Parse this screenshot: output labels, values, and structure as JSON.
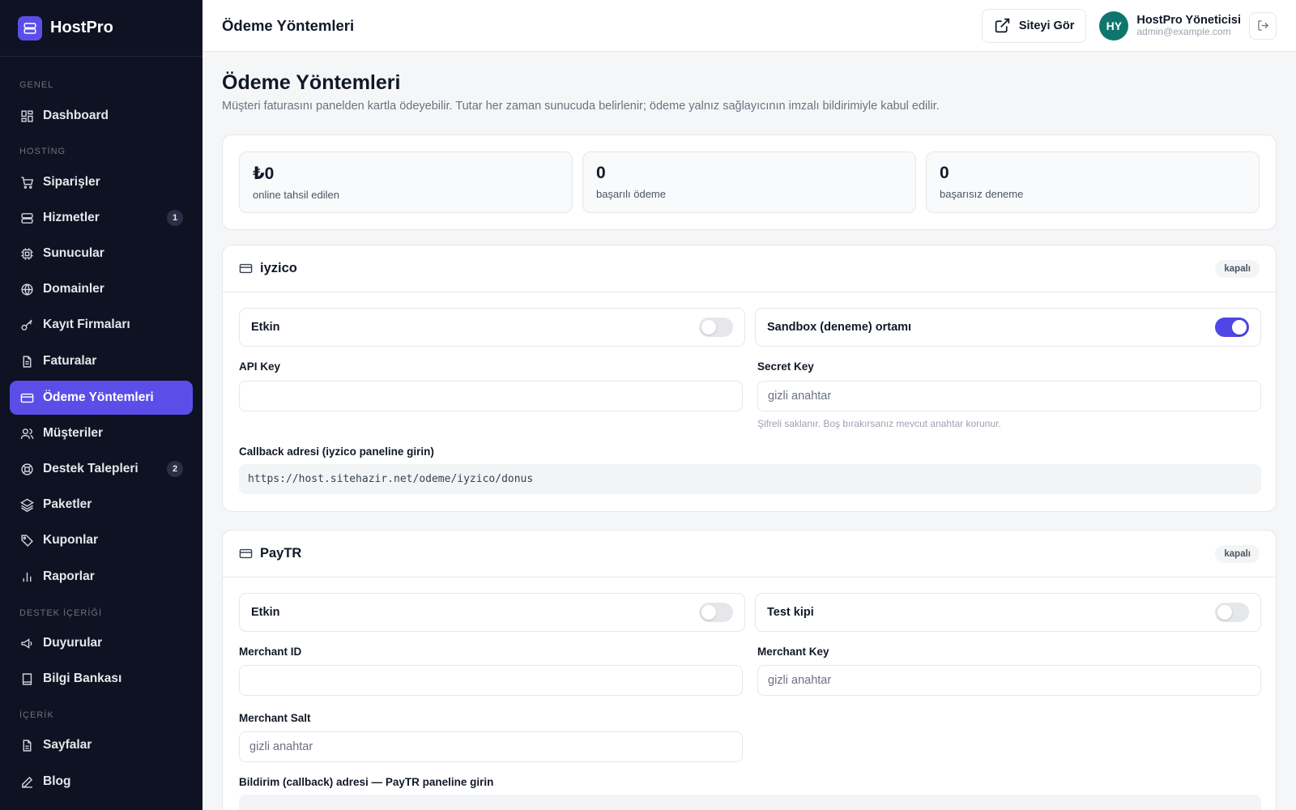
{
  "brand": {
    "name": "HostPro"
  },
  "sidebar": {
    "sections": [
      {
        "label": "GENEL"
      },
      {
        "label": "HOSTİNG"
      },
      {
        "label": "DESTEK İÇERİĞİ"
      },
      {
        "label": "İÇERİK"
      }
    ],
    "items": [
      {
        "label": "Dashboard",
        "icon": "dashboard-icon"
      },
      {
        "label": "Siparişler",
        "icon": "cart-icon"
      },
      {
        "label": "Hizmetler",
        "icon": "server-icon",
        "badge": "1"
      },
      {
        "label": "Sunucular",
        "icon": "cpu-icon"
      },
      {
        "label": "Domainler",
        "icon": "globe-icon"
      },
      {
        "label": "Kayıt Firmaları",
        "icon": "key-icon"
      },
      {
        "label": "Faturalar",
        "icon": "invoice-icon"
      },
      {
        "label": "Ödeme Yöntemleri",
        "icon": "credit-card-icon",
        "active": true
      },
      {
        "label": "Müşteriler",
        "icon": "users-icon"
      },
      {
        "label": "Destek Talepleri",
        "icon": "lifebuoy-icon",
        "badge": "2"
      },
      {
        "label": "Paketler",
        "icon": "layers-icon"
      },
      {
        "label": "Kuponlar",
        "icon": "tag-icon"
      },
      {
        "label": "Raporlar",
        "icon": "bar-chart-icon"
      },
      {
        "label": "Duyurular",
        "icon": "megaphone-icon"
      },
      {
        "label": "Bilgi Bankası",
        "icon": "book-icon"
      },
      {
        "label": "Sayfalar",
        "icon": "file-icon"
      },
      {
        "label": "Blog",
        "icon": "edit-icon"
      }
    ]
  },
  "topbar": {
    "title": "Ödeme Yöntemleri",
    "view_site": "Siteyi Gör",
    "user": {
      "initials": "HY",
      "name": "HostPro Yöneticisi",
      "email": "admin@example.com"
    }
  },
  "page": {
    "title": "Ödeme Yöntemleri",
    "description": "Müşteri faturasını panelden kartla ödeyebilir. Tutar her zaman sunucuda belirlenir; ödeme yalnız sağlayıcının imzalı bildirimiyle kabul edilir."
  },
  "stats": [
    {
      "value": "₺0",
      "label": "online tahsil edilen"
    },
    {
      "value": "0",
      "label": "başarılı ödeme"
    },
    {
      "value": "0",
      "label": "başarısız deneme"
    }
  ],
  "iyzico": {
    "name": "iyzico",
    "status": "kapalı",
    "enabled_label": "Etkin",
    "enabled": false,
    "sandbox_label": "Sandbox (deneme) ortamı",
    "sandbox": true,
    "api_key_label": "API Key",
    "api_key_value": "",
    "secret_key_label": "Secret Key",
    "secret_key_placeholder": "gizli anahtar",
    "secret_hint": "Şifreli saklanır. Boş bırakırsanız mevcut anahtar korunur.",
    "callback_label": "Callback adresi (iyzico paneline girin)",
    "callback_url": "https://host.sitehazir.net/odeme/iyzico/donus"
  },
  "paytr": {
    "name": "PayTR",
    "status": "kapalı",
    "enabled_label": "Etkin",
    "enabled": false,
    "test_label": "Test kipi",
    "test": false,
    "merchant_id_label": "Merchant ID",
    "merchant_id_value": "",
    "merchant_key_label": "Merchant Key",
    "merchant_key_placeholder": "gizli anahtar",
    "merchant_salt_label": "Merchant Salt",
    "merchant_salt_placeholder": "gizli anahtar",
    "callback_label": "Bildirim (callback) adresi — PayTR paneline girin"
  },
  "colors": {
    "accent": "#5b4ee8",
    "sidebar_bg": "#0f1222",
    "avatar": "#0f766e"
  }
}
